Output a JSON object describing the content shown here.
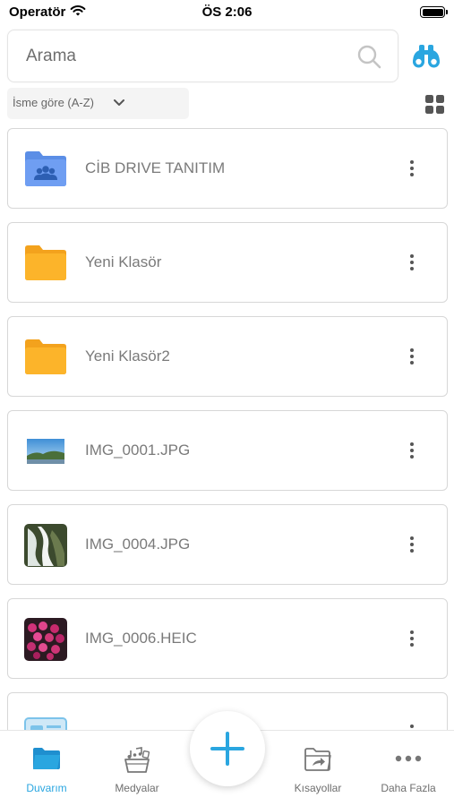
{
  "status_bar": {
    "carrier": "Operatör",
    "time": "ÖS 2:06"
  },
  "search": {
    "placeholder": "Arama",
    "value": "",
    "icons": [
      "search-icon",
      "binoculars-icon"
    ]
  },
  "sort": {
    "label": "İsme göre (A-Z)",
    "icon": "chevron-down-icon",
    "view_toggle_icon": "grid-view-icon"
  },
  "files": [
    {
      "name": "CİB DRIVE TANITIM",
      "type": "shared-folder",
      "icon": "shared-folder-icon",
      "color": "#6f9ef2"
    },
    {
      "name": "Yeni Klasör",
      "type": "folder",
      "icon": "folder-icon",
      "color": "#fcb42a"
    },
    {
      "name": "Yeni Klasör2",
      "type": "folder",
      "icon": "folder-icon",
      "color": "#fcb42a"
    },
    {
      "name": "IMG_0001.JPG",
      "type": "image",
      "icon": "image-thumbnail"
    },
    {
      "name": "IMG_0004.JPG",
      "type": "image",
      "icon": "image-thumbnail"
    },
    {
      "name": "IMG_0006.HEIC",
      "type": "image",
      "icon": "image-thumbnail"
    },
    {
      "name": "",
      "type": "image",
      "icon": "image-thumbnail"
    }
  ],
  "bottom_nav": {
    "items": [
      {
        "label": "Duvarım",
        "icon": "folder-icon",
        "active": true
      },
      {
        "label": "Medyalar",
        "icon": "media-icon",
        "active": false
      },
      {
        "label": "Kısayollar",
        "icon": "shortcut-folder-icon",
        "active": false
      },
      {
        "label": "Daha Fazla",
        "icon": "more-horizontal-icon",
        "active": false
      }
    ],
    "fab_icon": "plus-icon"
  },
  "colors": {
    "accent": "#2aa6e0",
    "folder": "#fcb42a",
    "shared_folder": "#6f9ef2"
  }
}
